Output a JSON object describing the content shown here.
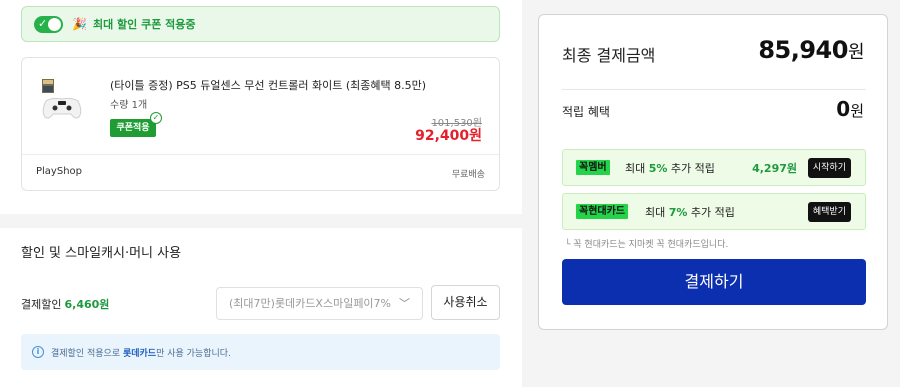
{
  "coupon_bar": {
    "text": "최대 할인 쿠폰 적용중",
    "toggle_on": true,
    "accent_color": "#26b14a"
  },
  "product": {
    "title": "(타이틀 증정) PS5 듀얼센스 무선 컨트롤러 화이트 (최종혜택 8.5만)",
    "quantity": "수량  1개",
    "coupon_badge": "쿠폰적용",
    "original_price": "101,530원",
    "sale_price": "92,400원",
    "shop_name": "PlayShop",
    "shipping": "무료배송"
  },
  "discount": {
    "heading": "할인 및 스마일캐시·머니 사용",
    "label": "결제할인",
    "amount": "6,460원",
    "select_value": "(최대7만)롯데카드X스마일페이7%",
    "cancel_label": "사용취소",
    "info_before": "결제할인 적용으로 ",
    "info_highlight": "롯데카드",
    "info_after": "만 사용 가능합니다."
  },
  "summary": {
    "total_label": "최종 결제금액",
    "total_amount": "85,940",
    "currency_unit": "원",
    "reward_label": "적립 혜택",
    "reward_amount": "0",
    "promos": [
      {
        "badge_prefix": "꼭",
        "badge_name": "멤버",
        "text_before": "최대 ",
        "pct": "5%",
        "text_after": " 추가 적립",
        "value": "4,297원",
        "button": "시작하기"
      },
      {
        "badge_prefix": "꼭",
        "badge_name": "현대카드",
        "text_before": "최대 ",
        "pct": "7%",
        "text_after": " 추가 적립",
        "value": "",
        "button": "혜택받기"
      }
    ],
    "promo_note": "└ 꼭 현대카드는 지마켓 꼭 현대카드입니다.",
    "pay_button": "결제하기",
    "pay_button_color": "#0b2fae"
  }
}
